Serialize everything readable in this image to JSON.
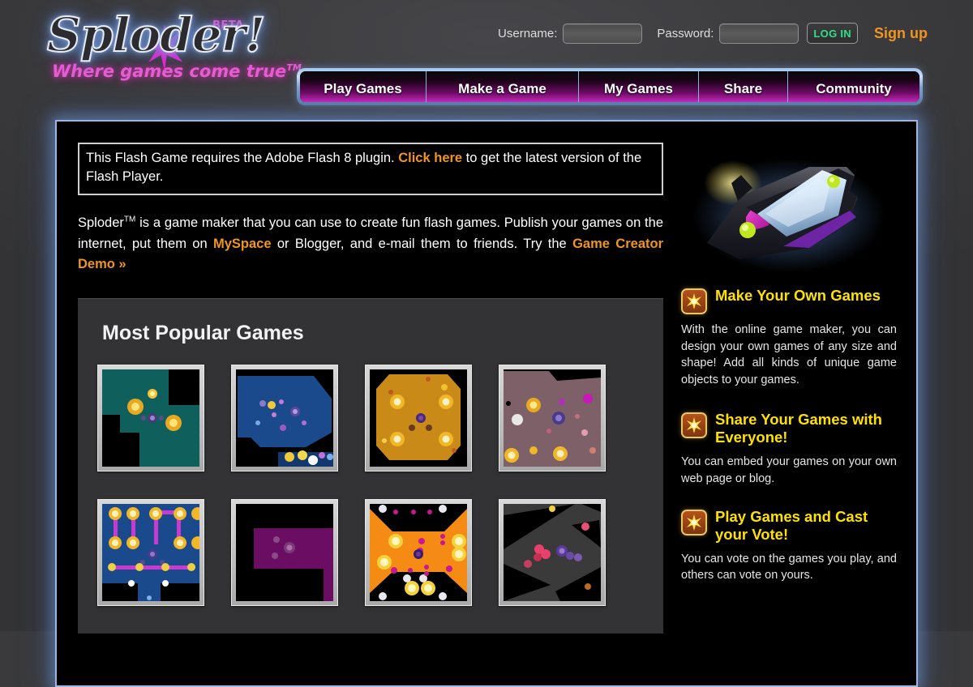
{
  "site": {
    "logo_text": "Sploder!",
    "tagline": "Where games come true",
    "tagline_tm": "TM",
    "beta_badge": "BETA"
  },
  "login": {
    "username_label": "Username:",
    "username_value": "",
    "username_placeholder": "",
    "password_label": "Password:",
    "password_value": "",
    "password_placeholder": "",
    "login_button": "LOG IN",
    "signup_link": "Sign up"
  },
  "nav": {
    "items": [
      {
        "label": "Play Games"
      },
      {
        "label": "Make a Game"
      },
      {
        "label": "My Games"
      },
      {
        "label": "Share"
      },
      {
        "label": "Community"
      }
    ]
  },
  "flash_notice": {
    "text_before": "This Flash Game requires the Adobe Flash 8 plugin. ",
    "link": "Click here",
    "text_after": " to get the latest version of the Flash Player."
  },
  "intro": {
    "part1": "Sploder",
    "tm": "TM",
    "part2": " is a game maker that you can use to create fun flash games. Publish your games on the internet, put them on ",
    "link1": "MySpace",
    "part3": " or Blogger, and e-mail them to friends. Try the ",
    "link2": "Game Creator Demo »"
  },
  "popular": {
    "heading": "Most Popular Games",
    "thumbnails": [
      {
        "name": "game-thumb-1",
        "bg": "#0f5f5c"
      },
      {
        "name": "game-thumb-2",
        "bg": "#1b4a8c"
      },
      {
        "name": "game-thumb-3",
        "bg": "#c98a18"
      },
      {
        "name": "game-thumb-4",
        "bg": "#7d6068"
      },
      {
        "name": "game-thumb-5",
        "bg": "#1b4a8c"
      },
      {
        "name": "game-thumb-6",
        "bg": "#6a0d63"
      },
      {
        "name": "game-thumb-7",
        "bg": "#f58a14"
      },
      {
        "name": "game-thumb-8",
        "bg": "#3a3a3a"
      }
    ]
  },
  "sidebar": {
    "ship_alt": "spaceship",
    "features": [
      {
        "icon": "starburst-icon",
        "title": "Make Your Own Games",
        "body": "With the online game maker, you can design your own games of any size and shape! Add all kinds of unique game objects to your games."
      },
      {
        "icon": "starburst-icon",
        "title": "Share Your Games with Everyone!",
        "body": "You can embed your games on your own web page or blog."
      },
      {
        "icon": "starburst-icon",
        "title": "Play Games and Cast your Vote!",
        "body": "You can vote on the games you play, and others can vote on yours."
      }
    ]
  },
  "colors": {
    "accent_orange": "#f09422",
    "accent_yellow": "#ffe100",
    "accent_pink": "#ef5ad8",
    "accent_green": "#2ee08a",
    "panel_border_blue": "#9db7e0"
  }
}
